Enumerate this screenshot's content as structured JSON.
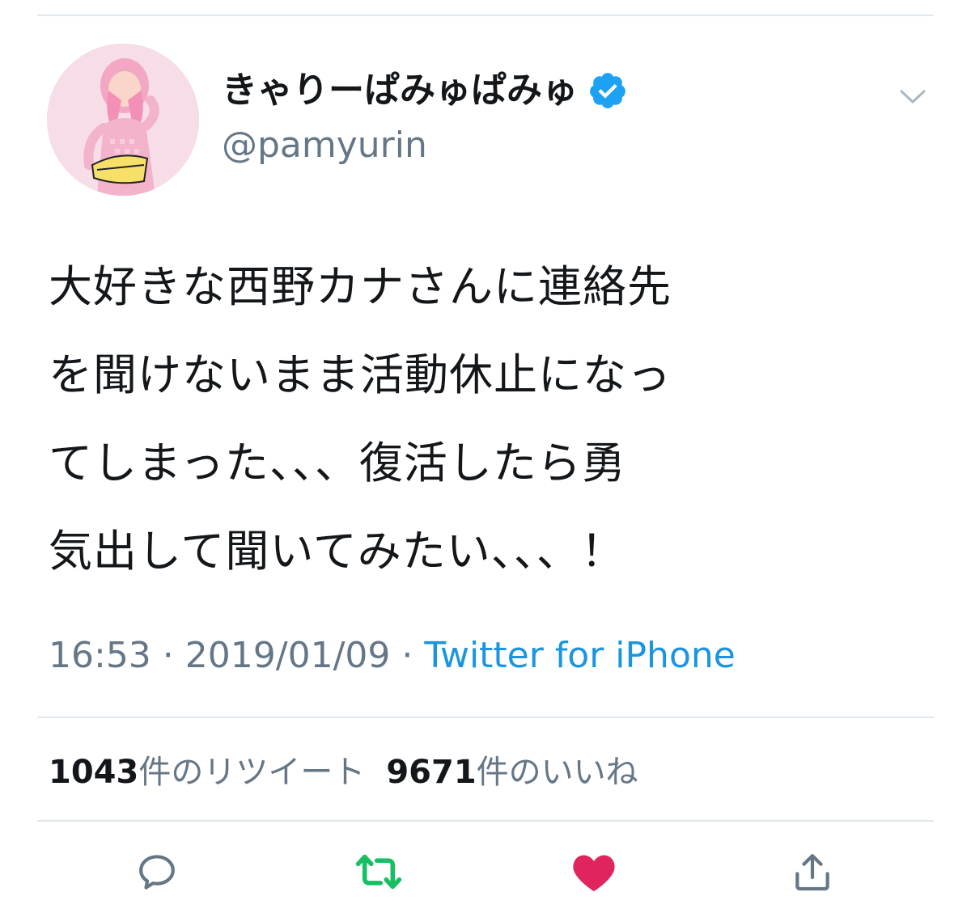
{
  "tweet": {
    "author": {
      "display_name": "きゃりーぱみゅぱみゅ",
      "handle": "@pamyurin",
      "verified": true
    },
    "text_lines": [
      "大好きな西野カナさんに連絡先",
      "を聞けないまま活動休止になっ",
      "てしまった、、、復活したら勇",
      "気出して聞いてみたい、、、！"
    ],
    "time": "16:53",
    "separator": " · ",
    "date": "2019/01/09",
    "source": "Twitter for iPhone",
    "stats": {
      "retweet_count": "1043",
      "retweet_label": "件のリツイート",
      "like_count": "9671",
      "like_label": "件のいいね"
    }
  },
  "icons": {
    "verified": "verified-badge-icon",
    "menu": "chevron-down-icon",
    "reply": "reply-icon",
    "retweet": "retweet-icon",
    "like": "heart-icon",
    "share": "share-icon"
  },
  "colors": {
    "text_primary": "#14171a",
    "text_secondary": "#657786",
    "link": "#1b95e0",
    "verified": "#1da1f2",
    "retweet_active": "#17bf63",
    "like_active": "#e0245e",
    "divider": "#e1e8ed"
  }
}
